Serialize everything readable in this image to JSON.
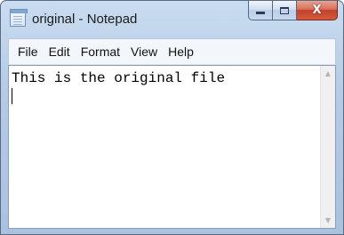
{
  "window": {
    "title": "original - Notepad",
    "min_glyph": "",
    "max_glyph": "",
    "close_glyph": "X"
  },
  "menu": {
    "items": [
      "File",
      "Edit",
      "Format",
      "View",
      "Help"
    ]
  },
  "editor": {
    "content": "This is the original file"
  },
  "scrollbar": {
    "up_glyph": "▲",
    "down_glyph": "▼"
  }
}
